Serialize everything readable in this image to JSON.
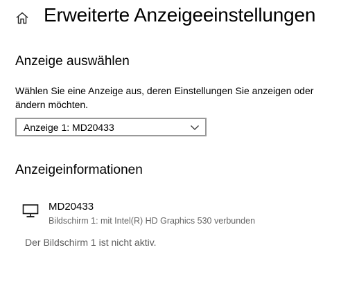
{
  "header": {
    "title": "Erweiterte Anzeigeeinstellungen",
    "home_icon": "home-icon"
  },
  "select_display": {
    "heading": "Anzeige auswählen",
    "description": "Wählen Sie eine Anzeige aus, deren Einstellungen Sie anzeigen oder ändern möchten.",
    "selected_value": "Anzeige 1: MD20433",
    "chevron_icon": "chevron-down-icon"
  },
  "display_info": {
    "heading": "Anzeigeinformationen",
    "monitor_icon": "monitor-icon",
    "name": "MD20433",
    "connection": "Bildschirm 1: mit Intel(R) HD Graphics 530 verbunden",
    "status": "Der Bildschirm 1 ist nicht aktiv."
  },
  "colors": {
    "text": "#000000",
    "secondary_text": "#666666",
    "border": "#999999",
    "background": "#ffffff"
  }
}
